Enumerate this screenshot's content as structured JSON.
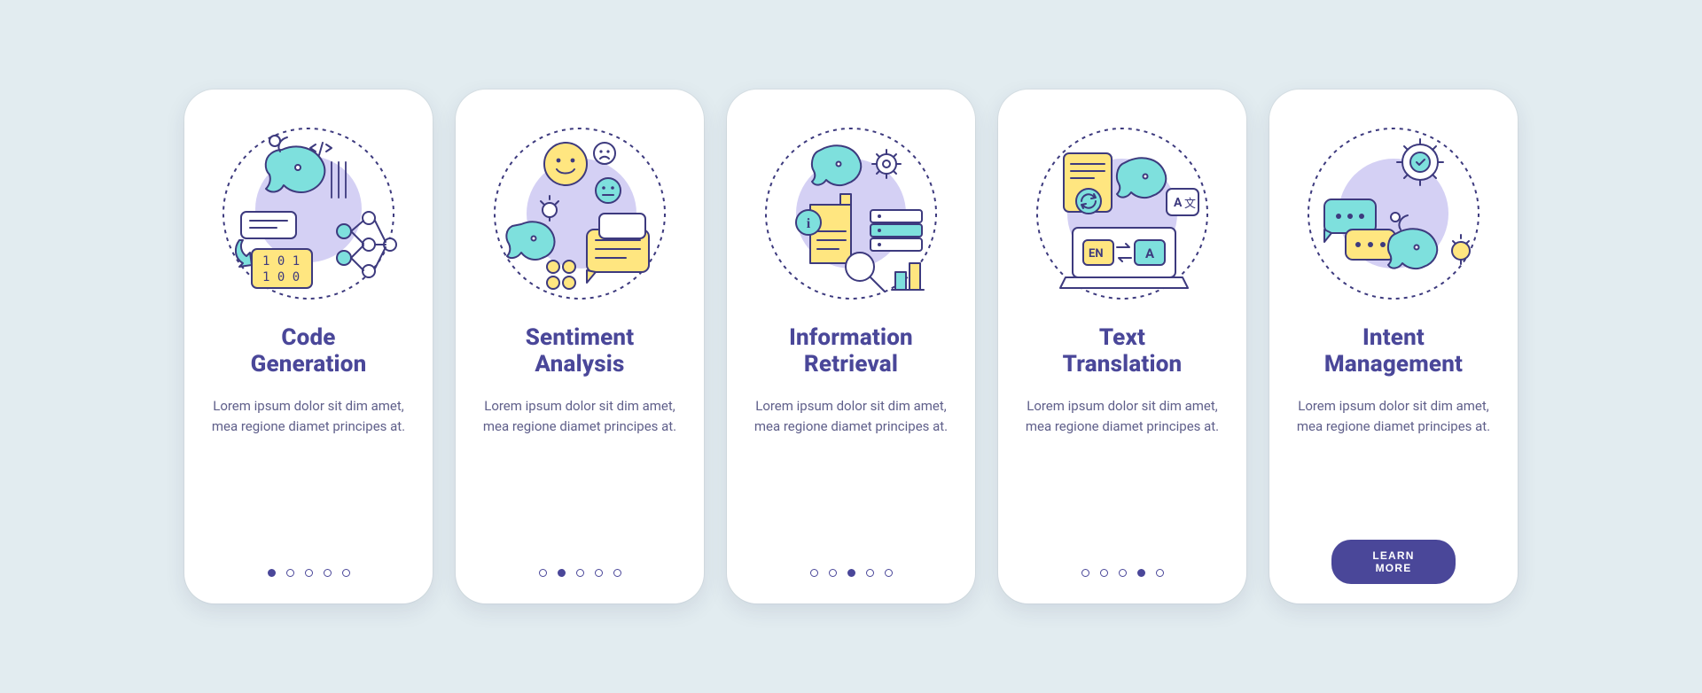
{
  "common_desc": "Lorem ipsum dolor sit dim amet, mea regione diamet principes at.",
  "learn_more_label": "LEARN MORE",
  "cards": [
    {
      "title_l1": "Code",
      "title_l2": "Generation"
    },
    {
      "title_l1": "Sentiment",
      "title_l2": "Analysis"
    },
    {
      "title_l1": "Information",
      "title_l2": "Retrieval"
    },
    {
      "title_l1": "Text",
      "title_l2": "Translation"
    },
    {
      "title_l1": "Intent",
      "title_l2": "Management"
    }
  ],
  "total_pages": 5
}
